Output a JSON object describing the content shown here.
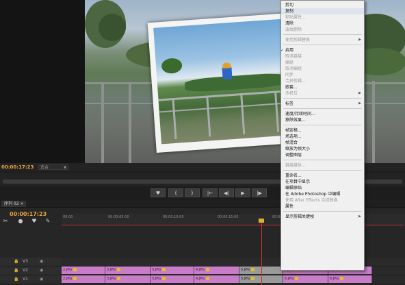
{
  "program_monitor": {
    "timecode": "00:00:17:23",
    "fit_option": "适合"
  },
  "transport": {
    "buttons": [
      "{",
      "}",
      "|←",
      "◀|",
      "▶",
      "|▶",
      "→|"
    ]
  },
  "timeline": {
    "tab_label": "序列 02 ×",
    "timecode": "00:00:17:23",
    "ruler_ticks": [
      "00:00",
      "00:00:05:00",
      "00:00:10:00",
      "00:00:15:00",
      "00:00:20:00"
    ],
    "tracks": [
      {
        "name": "V3"
      },
      {
        "name": "V2"
      },
      {
        "name": "V1"
      }
    ],
    "clips_v2": [
      "2.JPG",
      "3.JPG",
      "3.JPG",
      "4.JPG",
      "5.JPG",
      "6.JPG",
      "6.JPG"
    ],
    "clips_v1": [
      "2.JPG",
      "3.JPG",
      "3.JPG",
      "4.JPG",
      "5.JPG",
      "6.JPG",
      "6.JPG"
    ]
  },
  "context_menu": {
    "items": [
      {
        "label": "剪切",
        "disabled": false
      },
      {
        "label": "复制",
        "disabled": false,
        "highlight": true
      },
      {
        "label": "粘贴属性...",
        "disabled": true
      },
      {
        "label": "清除",
        "disabled": false
      },
      {
        "label": "波纹删除",
        "disabled": true
      },
      {
        "sep": true
      },
      {
        "label": "使用剪辑替换",
        "disabled": true,
        "submenu": true
      },
      {
        "sep": true
      },
      {
        "label": "启用",
        "disabled": false,
        "checked": true
      },
      {
        "label": "取消链接",
        "disabled": true
      },
      {
        "label": "编组",
        "disabled": true
      },
      {
        "label": "取消编组",
        "disabled": true
      },
      {
        "label": "同步",
        "disabled": true
      },
      {
        "label": "合并剪辑...",
        "disabled": true
      },
      {
        "label": "嵌套...",
        "disabled": false
      },
      {
        "label": "多机位",
        "disabled": true,
        "submenu": true
      },
      {
        "sep": true
      },
      {
        "label": "标签",
        "disabled": false,
        "submenu": true
      },
      {
        "sep": true
      },
      {
        "label": "速度/持续时间...",
        "disabled": false
      },
      {
        "label": "移除效果...",
        "disabled": false
      },
      {
        "sep": true
      },
      {
        "label": "帧定格...",
        "disabled": false
      },
      {
        "label": "场选项...",
        "disabled": false
      },
      {
        "label": "帧混合",
        "disabled": false
      },
      {
        "label": "缩放为帧大小",
        "disabled": false
      },
      {
        "label": "调整图层",
        "disabled": false
      },
      {
        "sep": true
      },
      {
        "label": "链接媒体...",
        "disabled": true
      },
      {
        "sep": true
      },
      {
        "label": "重命名...",
        "disabled": false
      },
      {
        "label": "在项目中显示",
        "disabled": false
      },
      {
        "label": "编辑原始",
        "disabled": false
      },
      {
        "label": "在 Adobe Photoshop 中编辑",
        "disabled": false
      },
      {
        "label": "使用 After Effects 合成替换",
        "disabled": true
      },
      {
        "label": "属性",
        "disabled": false
      },
      {
        "sep": true
      },
      {
        "label": "显示剪辑关键帧",
        "disabled": false,
        "submenu": true
      }
    ]
  },
  "colors": {
    "timecode": "#e8a33c",
    "clip": "#c97dc8",
    "playhead": "#d0302a"
  }
}
